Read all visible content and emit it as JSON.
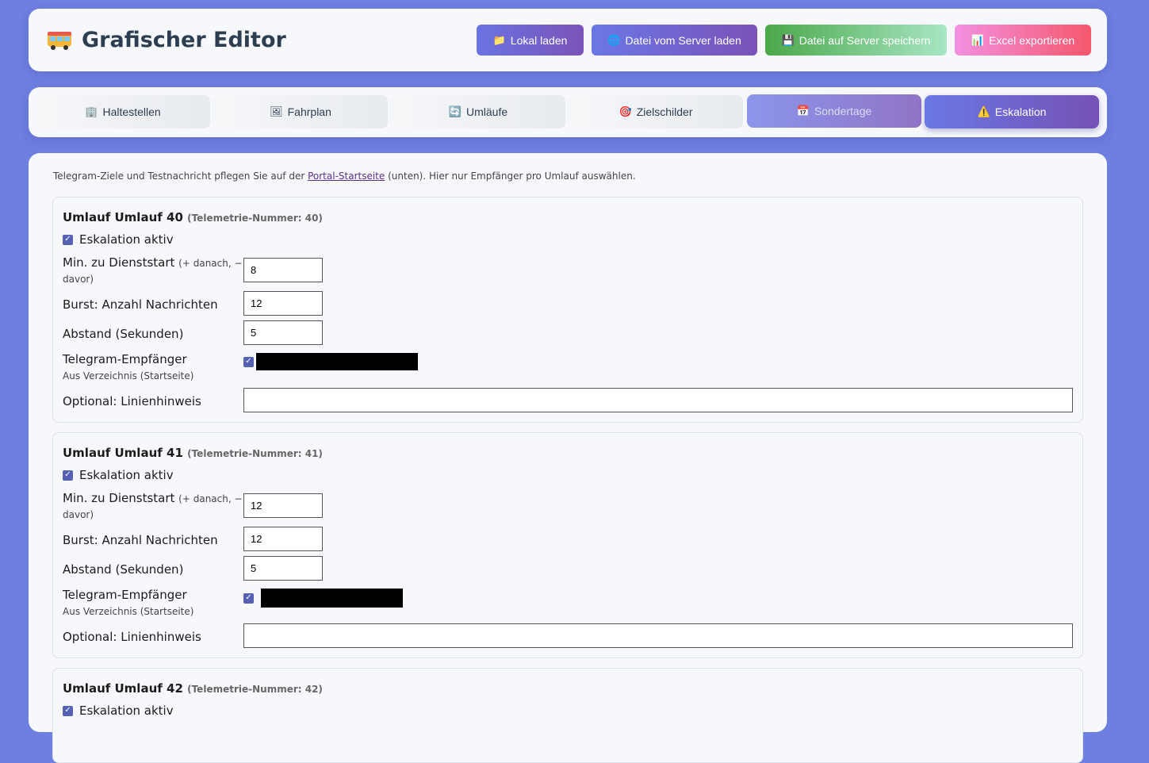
{
  "header": {
    "title": "Grafischer Editor",
    "logo_icon": "bus-icon",
    "buttons": [
      {
        "label": "Lokal laden",
        "icon": "📁"
      },
      {
        "label": "Datei vom Server laden",
        "icon": "🌐"
      },
      {
        "label": "Datei auf Server speichern",
        "icon": "💾"
      },
      {
        "label": "Excel exportieren",
        "icon": "📊"
      }
    ]
  },
  "tabs": [
    {
      "label": "Haltestellen",
      "icon": "🏢"
    },
    {
      "label": "Fahrplan",
      "icon": "🖼"
    },
    {
      "label": "Umläufe",
      "icon": "🔄"
    },
    {
      "label": "Zielschilder",
      "icon": "🎯"
    },
    {
      "label": "Sondertage",
      "icon": "📅"
    },
    {
      "label": "Eskalation",
      "icon": "⚠️"
    }
  ],
  "intro": {
    "before": "Telegram-Ziele und Testnachricht pflegen Sie auf der ",
    "link": "Portal-Startseite",
    "after": " (unten). Hier nur Empfänger pro Umlauf auswählen."
  },
  "labels": {
    "active": "Eskalation aktiv",
    "min_start": "Min. zu Dienststart",
    "min_hint": "(+ danach, −",
    "min_hint2": "davor)",
    "burst": "Burst: Anzahl Nachrichten",
    "interval": "Abstand (Sekunden)",
    "recipients": "Telegram-Empfänger",
    "recipients_sub": "Aus Verzeichnis (Startseite)",
    "line_hint": "Optional: Linienhinweis"
  },
  "cards": [
    {
      "title": "Umlauf Umlauf 40",
      "telemetry": "(Telemetrie-Nummer: 40)",
      "min": "8",
      "burst": "12",
      "interval": "5",
      "line_hint": ""
    },
    {
      "title": "Umlauf Umlauf 41",
      "telemetry": "(Telemetrie-Nummer: 41)",
      "min": "12",
      "burst": "12",
      "interval": "5",
      "line_hint": ""
    },
    {
      "title": "Umlauf Umlauf 42",
      "telemetry": "(Telemetrie-Nummer: 42)",
      "min": "",
      "burst": "",
      "interval": "",
      "line_hint": ""
    }
  ]
}
